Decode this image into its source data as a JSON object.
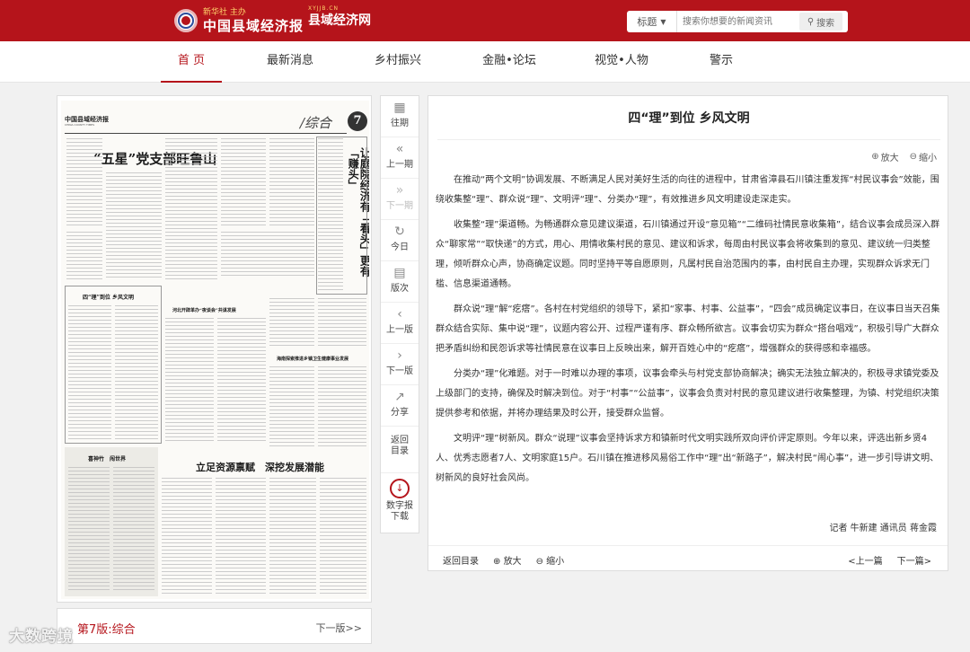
{
  "header": {
    "logo_small": "新华社 主办",
    "logo_main": "中国县域经济报",
    "logo2_small": "XYJJB.CN",
    "logo2_main": "县域经济网",
    "search_type": "标题",
    "search_placeholder": "搜索你想要的新闻资讯",
    "search_button": "搜索"
  },
  "nav": {
    "items": [
      "首 页",
      "最新消息",
      "乡村振兴",
      "金融•论坛",
      "视觉•人物",
      "警示"
    ],
    "active": 0
  },
  "paper": {
    "masthead": "中国县域经济报",
    "masthead_en": "CHINA COUNTY TIMES",
    "section": "/综合",
    "page_num": "7",
    "headline_main": "“五星”党支部旺鲁山",
    "headline_small1": "四“理”到位 乡风文明",
    "headline_small2": "河北开辟革办“夜谈会”共谋发展",
    "headline_small3": "海南探索推进乡镇卫生健康事业发展",
    "headline_bottom": "立足资源禀赋　深挖发展潜能",
    "headline_box": "喜神竹　闯世界",
    "vertical_headline": "让庭院经济有「看头」更有「赚头」",
    "pager_label": "第7版:综合",
    "pager_next": "下一版>>"
  },
  "toolbar": [
    {
      "icon": "calendar-icon",
      "glyph": "▦",
      "label": "往期"
    },
    {
      "icon": "double-chevron-left-icon",
      "glyph": "«",
      "label": "上一期"
    },
    {
      "icon": "double-chevron-right-icon",
      "glyph": "»",
      "label": "下一期"
    },
    {
      "icon": "refresh-icon",
      "glyph": "↻",
      "label": "今日"
    },
    {
      "icon": "layout-icon",
      "glyph": "▤",
      "label": "版次"
    },
    {
      "icon": "circle-left-icon",
      "glyph": "‹",
      "label": "上一版"
    },
    {
      "icon": "circle-right-icon",
      "glyph": "›",
      "label": "下一版"
    },
    {
      "icon": "share-icon",
      "glyph": "↗",
      "label": "分享"
    },
    {
      "icon": "",
      "glyph": "",
      "label": "返回目录"
    },
    {
      "icon": "download-icon",
      "glyph": "↓",
      "label": "数字报下载"
    }
  ],
  "article": {
    "title": "四“理”到位 乡风文明",
    "zoom_in": "放大",
    "zoom_out": "缩小",
    "paragraphs": [
      "在推动“两个文明”协调发展、不断满足人民对美好生活的向往的进程中，甘肃省漳县石川镇注重发挥“村民议事会”效能，围绕收集整“理”、群众说“理”、文明评“理”、分类办“理”，有效推进乡风文明建设走深走实。",
      "收集整“理”渠道畅。为畅通群众意见建议渠道，石川镇通过开设“意见箱”“二维码社情民意收集箱”，结合议事会成员深入群众“聊家常”“取快递”的方式，用心、用情收集村民的意见、建议和诉求，每周由村民议事会将收集到的意见、建议统一归类整理，倾听群众心声，协商确定议题。同时坚持平等自愿原则，凡属村民自治范围内的事，由村民自主办理，实现群众诉求无门槛、信息渠道通畅。",
      "群众说“理”解“疙瘩”。各村在村党组织的领导下，紧扣“家事、村事、公益事”，“四会”成员确定议事日，在议事日当天召集群众结合实际、集中说“理”，议题内容公开、过程严谨有序、群众畅所欲言。议事会切实为群众“搭台唱戏”，积极引导广大群众把矛盾纠纷和民怨诉求等社情民意在议事日上反映出来，解开百姓心中的“疙瘩”，增强群众的获得感和幸福感。",
      "分类办“理”化难题。对于一时难以办理的事项，议事会牵头与村党支部协商解决；确实无法独立解决的，积极寻求镇党委及上级部门的支持，确保及时解决到位。对于“村事”“公益事”，议事会负责对村民的意见建议进行收集整理，为镇、村党组织决策提供参考和依据，并将办理结果及时公开，接受群众监督。",
      "文明评“理”树新风。群众“说理”议事会坚持诉求方和镇新时代文明实践所双向评价评定原则。今年以来，评选出新乡贤4人、优秀志愿者7人、文明家庭15户。石川镇在推进移风易俗工作中“理”出“新路子”，解决村民“闹心事”，进一步引导讲文明、树新风的良好社会风尚。"
    ],
    "byline": "记者 牛新建 通讯员 蒋金霞",
    "footer_back": "返回目录",
    "footer_zoom_in": "放大",
    "footer_zoom_out": "缩小",
    "prev": "<上一篇",
    "next": "下一篇>"
  },
  "watermark": "大数跨境"
}
